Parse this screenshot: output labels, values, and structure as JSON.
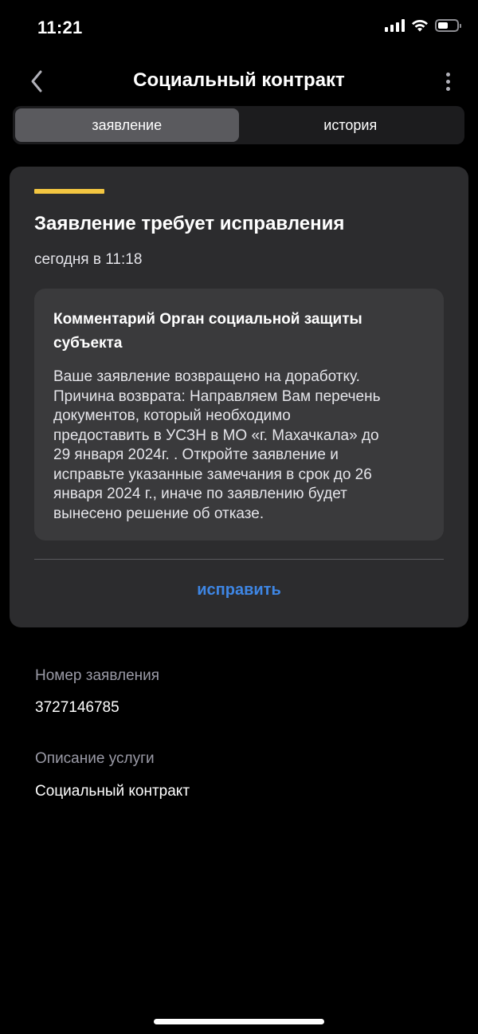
{
  "status_bar": {
    "time": "11:21",
    "icons": [
      "cellular-signal-icon",
      "wifi-icon",
      "battery-icon"
    ],
    "battery_level": 0.55
  },
  "header": {
    "title": "Социальный контракт",
    "back_icon": "chevron-left-icon",
    "more_icon": "more-vertical-icon"
  },
  "tabs": [
    {
      "label": "заявление",
      "active": true
    },
    {
      "label": "история",
      "active": false
    }
  ],
  "status_card": {
    "accent_color": "#f3c641",
    "title": "Заявление требует исправления",
    "date": "сегодня в 11:18",
    "comment": {
      "heading_line1": "Комментарий Орган социальной защиты",
      "heading_line2": "субъекта",
      "body_lines": [
        "Ваше заявление возвращено на доработку.",
        "Причина возврата: Направляем Вам перечень",
        "документов, который необходимо",
        "предоставить в УСЗН в МО «г. Махачкала» до",
        "29 января 2024г. . Откройте заявление и",
        "исправьте указанные замечания в срок до 26",
        "января 2024 г., иначе по заявлению будет",
        "вынесено решение об отказе."
      ]
    },
    "action_label": "исправить",
    "action_color": "#3e86e4"
  },
  "details": {
    "application_number_label": "Номер заявления",
    "application_number": "3727146785",
    "service_description_label": "Описание услуги",
    "service_description": "Социальный контракт"
  }
}
